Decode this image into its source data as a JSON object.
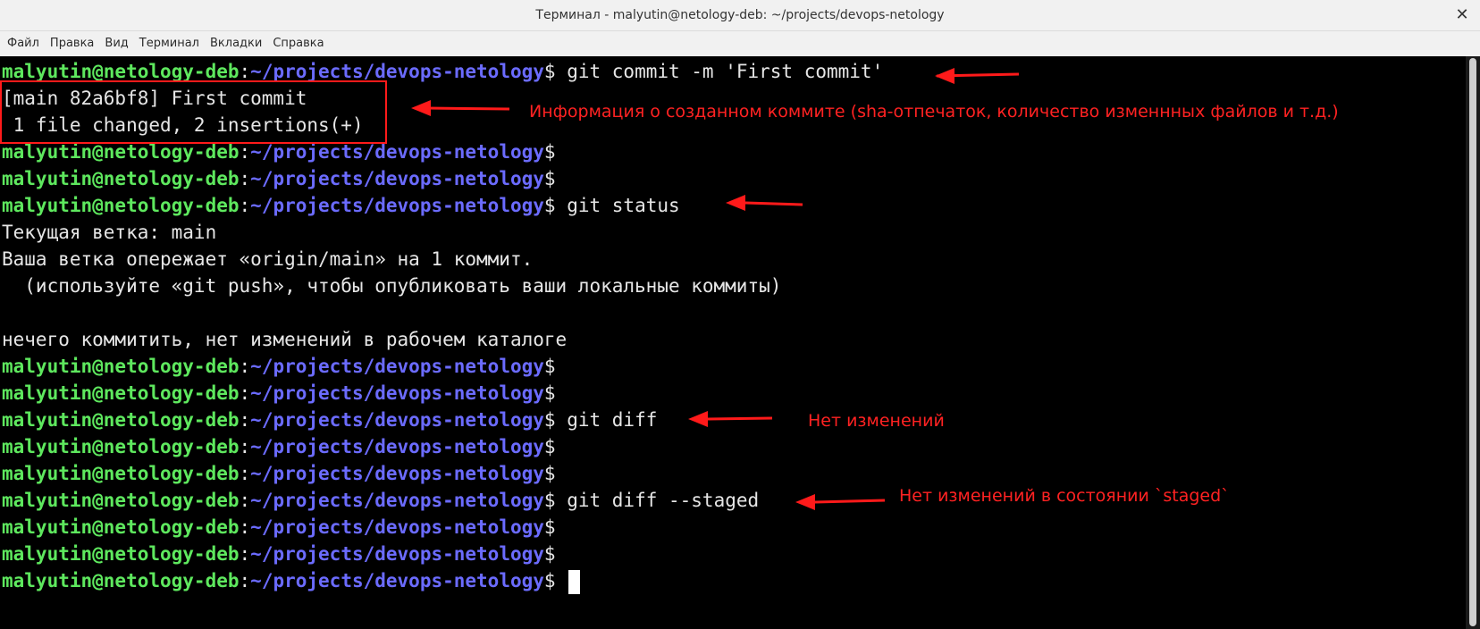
{
  "window": {
    "title": "Терминал - malyutin@netology-deb: ~/projects/devops-netology",
    "close_glyph": "✕"
  },
  "menu": [
    "Файл",
    "Правка",
    "Вид",
    "Терминал",
    "Вкладки",
    "Справка"
  ],
  "prompt": {
    "user": "malyutin@netology-deb",
    "colon": ":",
    "path": "~/projects/devops-netology",
    "dollar": "$"
  },
  "lines": [
    {
      "type": "prompt",
      "cmd": " git commit -m 'First commit'"
    },
    {
      "type": "text",
      "text": "[main 82a6bf8] First commit"
    },
    {
      "type": "text",
      "text": " 1 file changed, 2 insertions(+)"
    },
    {
      "type": "prompt",
      "cmd": ""
    },
    {
      "type": "prompt",
      "cmd": ""
    },
    {
      "type": "prompt",
      "cmd": " git status"
    },
    {
      "type": "text",
      "text": "Текущая ветка: main"
    },
    {
      "type": "text",
      "text": "Ваша ветка опережает «origin/main» на 1 коммит."
    },
    {
      "type": "text",
      "text": "  (используйте «git push», чтобы опубликовать ваши локальные коммиты)"
    },
    {
      "type": "text",
      "text": ""
    },
    {
      "type": "text",
      "text": "нечего коммитить, нет изменений в рабочем каталоге"
    },
    {
      "type": "prompt",
      "cmd": ""
    },
    {
      "type": "prompt",
      "cmd": ""
    },
    {
      "type": "prompt",
      "cmd": " git diff"
    },
    {
      "type": "prompt",
      "cmd": ""
    },
    {
      "type": "prompt",
      "cmd": ""
    },
    {
      "type": "prompt",
      "cmd": " git diff --staged"
    },
    {
      "type": "prompt",
      "cmd": ""
    },
    {
      "type": "prompt",
      "cmd": ""
    },
    {
      "type": "prompt",
      "cmd": " ",
      "cursor": true
    }
  ],
  "annotations": {
    "commit_info": "Информация о созданном коммите (sha-отпечаток, количество изменнных файлов и т.д.)",
    "no_changes": "Нет изменений",
    "no_staged_changes": "Нет изменений в состоянии `staged`"
  },
  "colors": {
    "annotation": "#ff1a1a",
    "prompt_user": "#5ee85e",
    "prompt_path": "#6b6bff"
  }
}
